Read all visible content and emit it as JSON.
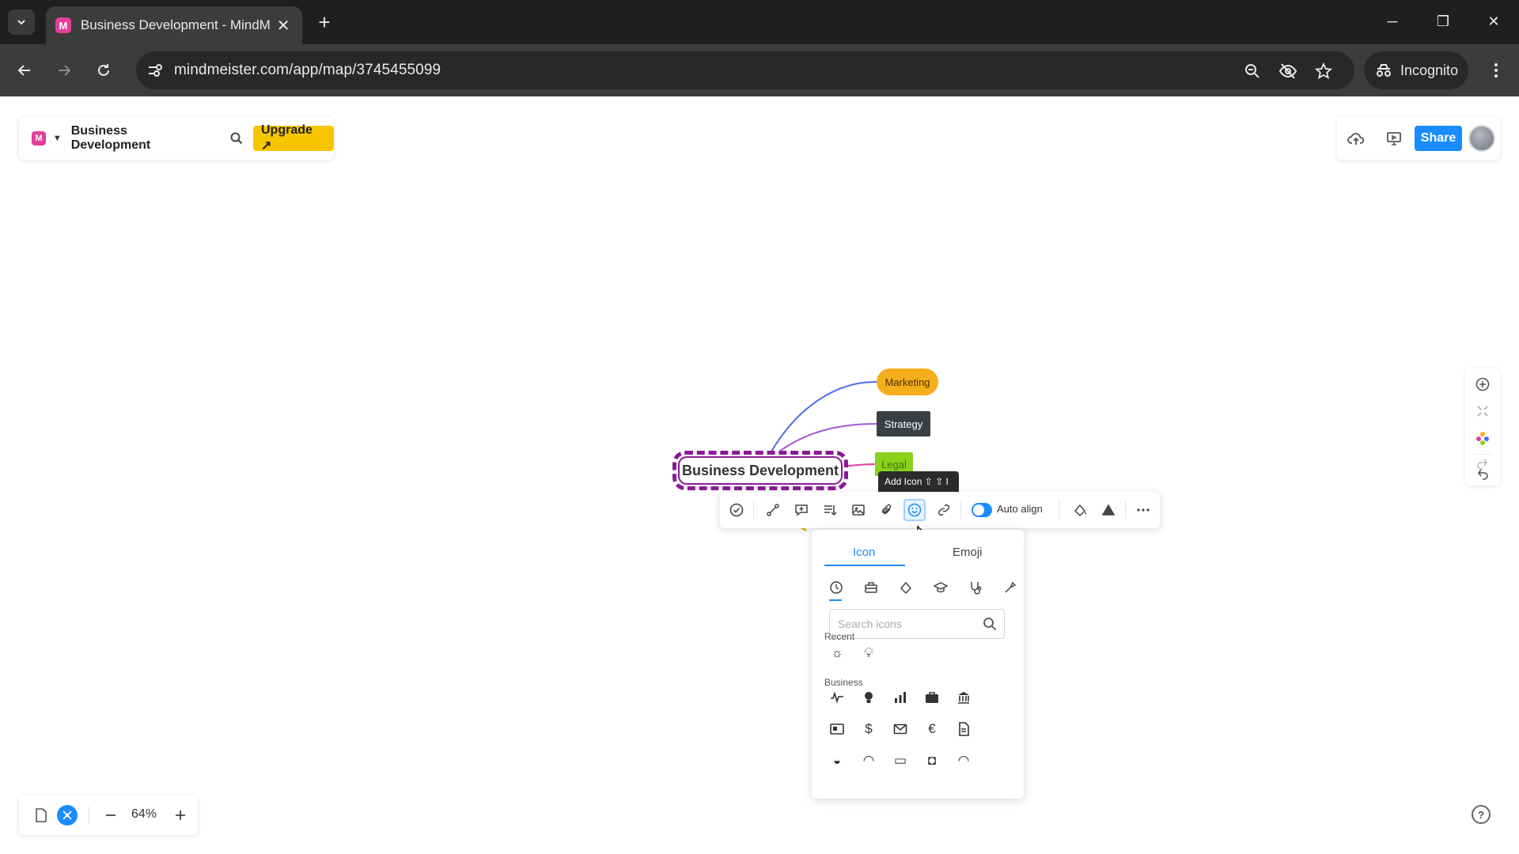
{
  "browser": {
    "tab_title": "Business Development - MindM",
    "url": "mindmeister.com/app/map/3745455099",
    "incognito_label": "Incognito"
  },
  "app": {
    "logo_letter": "M",
    "map_title": "Business Development",
    "upgrade_label": "Upgrade ↗",
    "share_label": "Share"
  },
  "map": {
    "root_label": "Business Development",
    "topics": [
      "Marketing",
      "Strategy",
      "Legal"
    ],
    "colors": {
      "marketing": "#f6ad1b",
      "strategy": "#3a3f44",
      "legal": "#8ad11a",
      "root_border": "#8a1a96"
    }
  },
  "tooltip": {
    "text": "Add Icon ⇧ ⇧ I"
  },
  "node_toolbar": {
    "auto_align_label": "Auto align",
    "auto_align_on": true
  },
  "icon_panel": {
    "tabs": [
      "Icon",
      "Emoji"
    ],
    "search_placeholder": "Search icons",
    "sections": [
      "Recent",
      "Business"
    ]
  },
  "zoom": {
    "value": "64%"
  },
  "accent_color": "#1a8cff"
}
